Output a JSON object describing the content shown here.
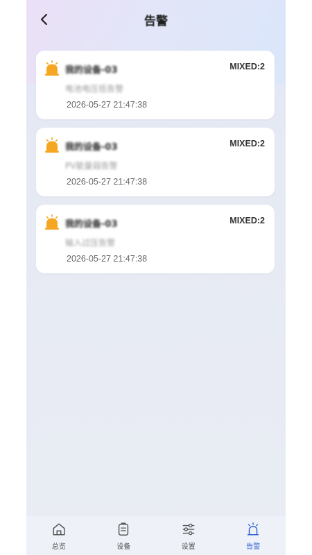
{
  "header": {
    "title": "告警"
  },
  "alarms": [
    {
      "device": "我的设备-03",
      "status": "MIXED:2",
      "type": "电池电压低告警",
      "time": "2026-05-27 21:47:38"
    },
    {
      "device": "我的设备-03",
      "status": "MIXED:2",
      "type": "PV能量弱告警",
      "time": "2026-05-27 21:47:38"
    },
    {
      "device": "我的设备-03",
      "status": "MIXED:2",
      "type": "输入过压告警",
      "time": "2026-05-27 21:47:38"
    }
  ],
  "tabbar": {
    "items": [
      {
        "label": "总览",
        "icon": "home-icon"
      },
      {
        "label": "设备",
        "icon": "device-icon"
      },
      {
        "label": "设置",
        "icon": "sliders-icon"
      },
      {
        "label": "告警",
        "icon": "alarm-icon",
        "active": true
      }
    ]
  },
  "colors": {
    "accent": "#2f5fd6",
    "bell": "#f5a623"
  }
}
